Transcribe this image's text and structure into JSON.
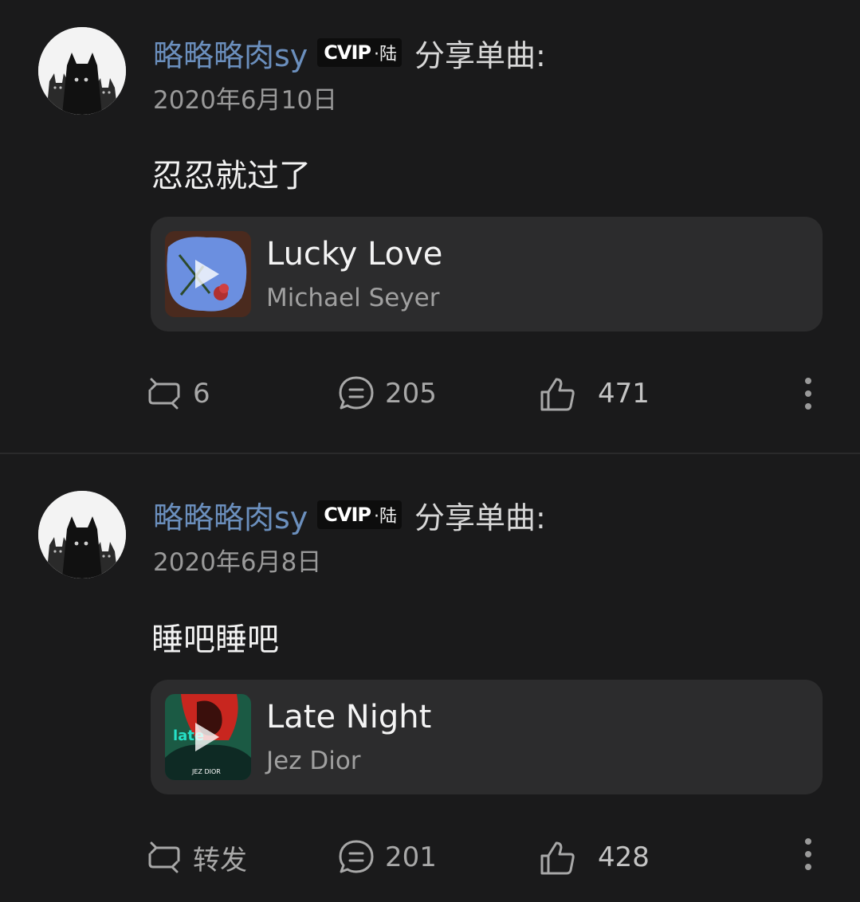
{
  "posts": [
    {
      "username": "略略略肉sy",
      "vip_badge": "CVIP",
      "vip_level": "·陆",
      "share_text": "分享单曲:",
      "date": "2020年6月10日",
      "content": "忍忍就过了",
      "song": {
        "title": "Lucky Love",
        "artist": "Michael Seyer"
      },
      "actions": {
        "repost": "6",
        "comment": "205",
        "like": "471"
      }
    },
    {
      "username": "略略略肉sy",
      "vip_badge": "CVIP",
      "vip_level": "·陆",
      "share_text": "分享单曲:",
      "date": "2020年6月8日",
      "content": "睡吧睡吧",
      "song": {
        "title": "Late Night",
        "artist": "Jez Dior",
        "cover_text": "JEZ DIOR"
      },
      "actions": {
        "repost": "转发",
        "comment": "201",
        "like": "428"
      }
    }
  ],
  "icons": {
    "repost": "repost-icon",
    "comment": "comment-icon",
    "like": "thumbs-up-icon",
    "more": "more-vertical-icon",
    "play": "play-icon"
  },
  "colors": {
    "background": "#1a1a1b",
    "card": "#2c2c2d",
    "username": "#6b8fbd",
    "secondary_text": "#9a9a9a"
  }
}
